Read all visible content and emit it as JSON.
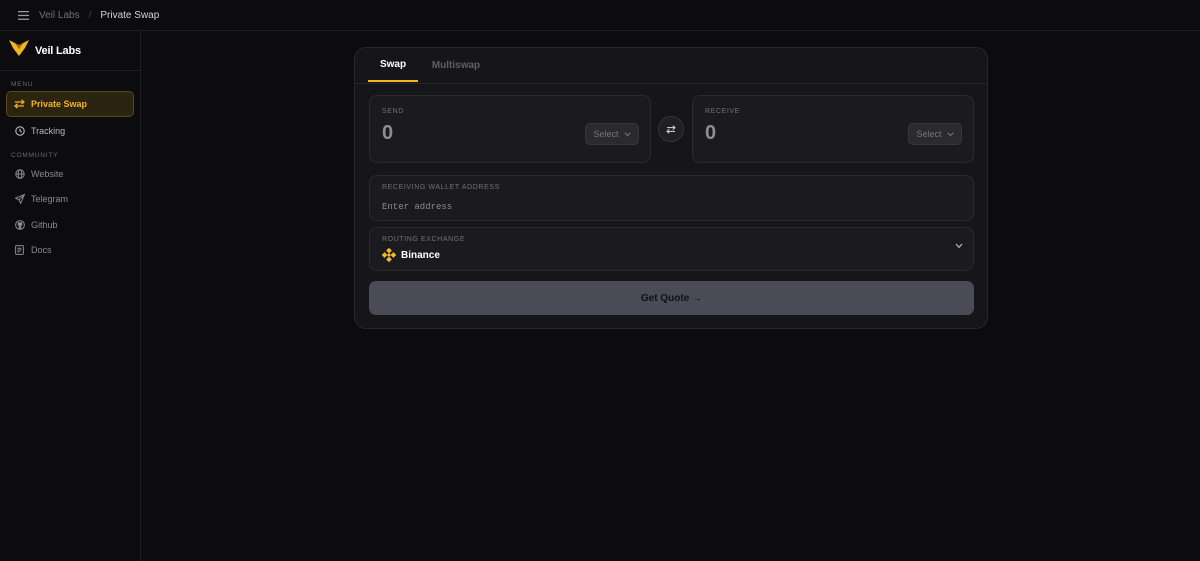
{
  "breadcrumb": {
    "root": "Veil Labs",
    "separator": "/",
    "current": "Private Swap"
  },
  "brand": {
    "name": "Veil Labs",
    "logo_icon": "fox-logo-icon",
    "accent": "#f2b51c"
  },
  "sidebar": {
    "menu_label": "MENU",
    "menu_items": [
      {
        "label": "Private Swap",
        "icon": "swap-arrows-icon",
        "active": true
      },
      {
        "label": "Tracking",
        "icon": "clock-icon",
        "active": false
      }
    ],
    "community_label": "COMMUNITY",
    "community_items": [
      {
        "label": "Website",
        "icon": "globe-icon"
      },
      {
        "label": "Telegram",
        "icon": "send-icon"
      },
      {
        "label": "Github",
        "icon": "github-icon"
      },
      {
        "label": "Docs",
        "icon": "document-icon"
      }
    ]
  },
  "swap": {
    "tabs": [
      {
        "label": "Swap",
        "active": true
      },
      {
        "label": "Multiswap",
        "active": false
      }
    ],
    "send": {
      "label": "SEND",
      "amount": "0",
      "select_label": "Select"
    },
    "receive": {
      "label": "RECEIVE",
      "amount": "0",
      "select_label": "Select"
    },
    "address": {
      "label": "RECEIVING WALLET ADDRESS",
      "placeholder": "Enter address"
    },
    "routing": {
      "label": "ROUTING EXCHANGE",
      "exchange": "Binance",
      "exchange_icon": "binance-icon",
      "exchange_color": "#f3ba2f"
    },
    "quote_button": "Get Quote →"
  }
}
